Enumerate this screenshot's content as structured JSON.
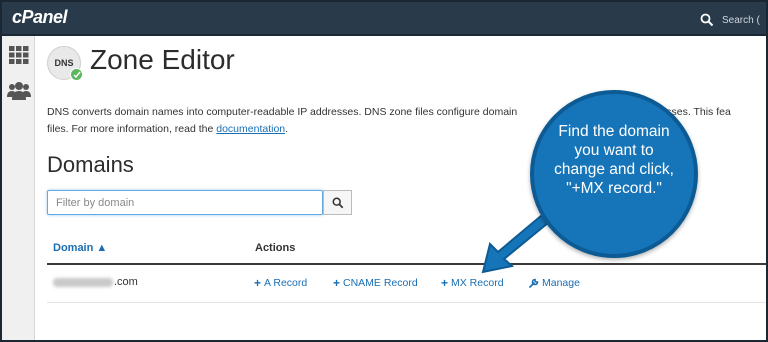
{
  "topbar": {
    "logo": "cPanel",
    "search_placeholder": "Search ("
  },
  "rail": {
    "items": [
      {
        "name": "grid-icon"
      },
      {
        "name": "users-icon"
      }
    ]
  },
  "header": {
    "badge": "DNS",
    "title": "Zone Editor"
  },
  "description": {
    "line1": "DNS converts domain names into computer-readable IP addresses. DNS zone files configure domain",
    "line1_tail": "ddresses. This fea",
    "line2": "files. For more information, read the",
    "link": "documentation",
    "line2_end": "."
  },
  "domains": {
    "title": "Domains",
    "filter_placeholder": "Filter by domain",
    "columns": {
      "domain": "Domain ▲",
      "actions": "Actions"
    },
    "rows": [
      {
        "domain_suffix": ".com",
        "actions": [
          "A Record",
          "CNAME Record",
          "MX Record",
          "Manage"
        ]
      }
    ]
  },
  "callout": {
    "line1": "Find the domain",
    "line2": "you want to",
    "line3": "change and click,",
    "line4": "\"+MX record.\""
  },
  "colors": {
    "topbar": "#293a4a",
    "link": "#1a6eb3",
    "callout": "#1675b8"
  }
}
